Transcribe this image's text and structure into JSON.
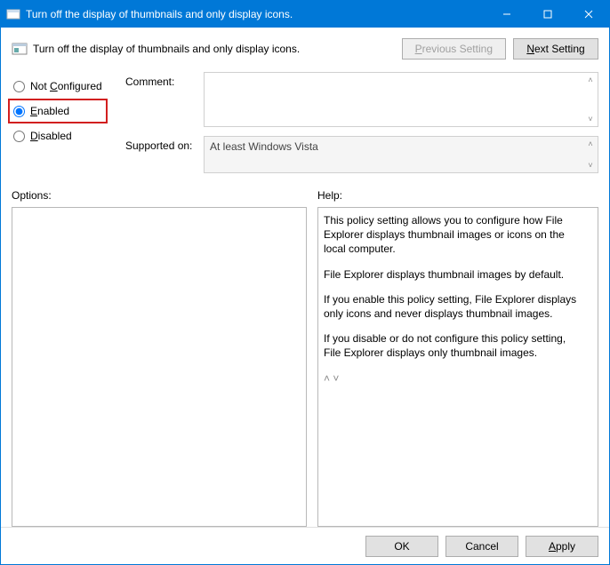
{
  "window": {
    "title": "Turn off the display of thumbnails and only display icons."
  },
  "header": {
    "title": "Turn off the display of thumbnails and only display icons.",
    "prev_label_pre": "P",
    "prev_label_mid": "revious Setting",
    "next_label_pre": "N",
    "next_label_mid": "ext Setting"
  },
  "radios": {
    "not_configured": {
      "pre": "Not ",
      "u": "C",
      "post": "onfigured"
    },
    "enabled": {
      "u": "E",
      "post": "nabled"
    },
    "disabled": {
      "u": "D",
      "post": "isabled"
    },
    "selected": "enabled"
  },
  "comment": {
    "label": "Comment:",
    "value": ""
  },
  "supported": {
    "label": "Supported on:",
    "value": "At least Windows Vista"
  },
  "options": {
    "label": "Options:"
  },
  "help": {
    "label": "Help:",
    "p1": "This policy setting allows you to configure how File Explorer displays thumbnail images or icons on the local computer.",
    "p2": "File Explorer displays thumbnail images by default.",
    "p3": "If you enable this policy setting, File Explorer displays only icons and never displays thumbnail images.",
    "p4": "If you disable or do not configure this policy setting, File Explorer displays only thumbnail images."
  },
  "footer": {
    "ok": "OK",
    "cancel": "Cancel",
    "apply_pre": "A",
    "apply_post": "pply"
  }
}
